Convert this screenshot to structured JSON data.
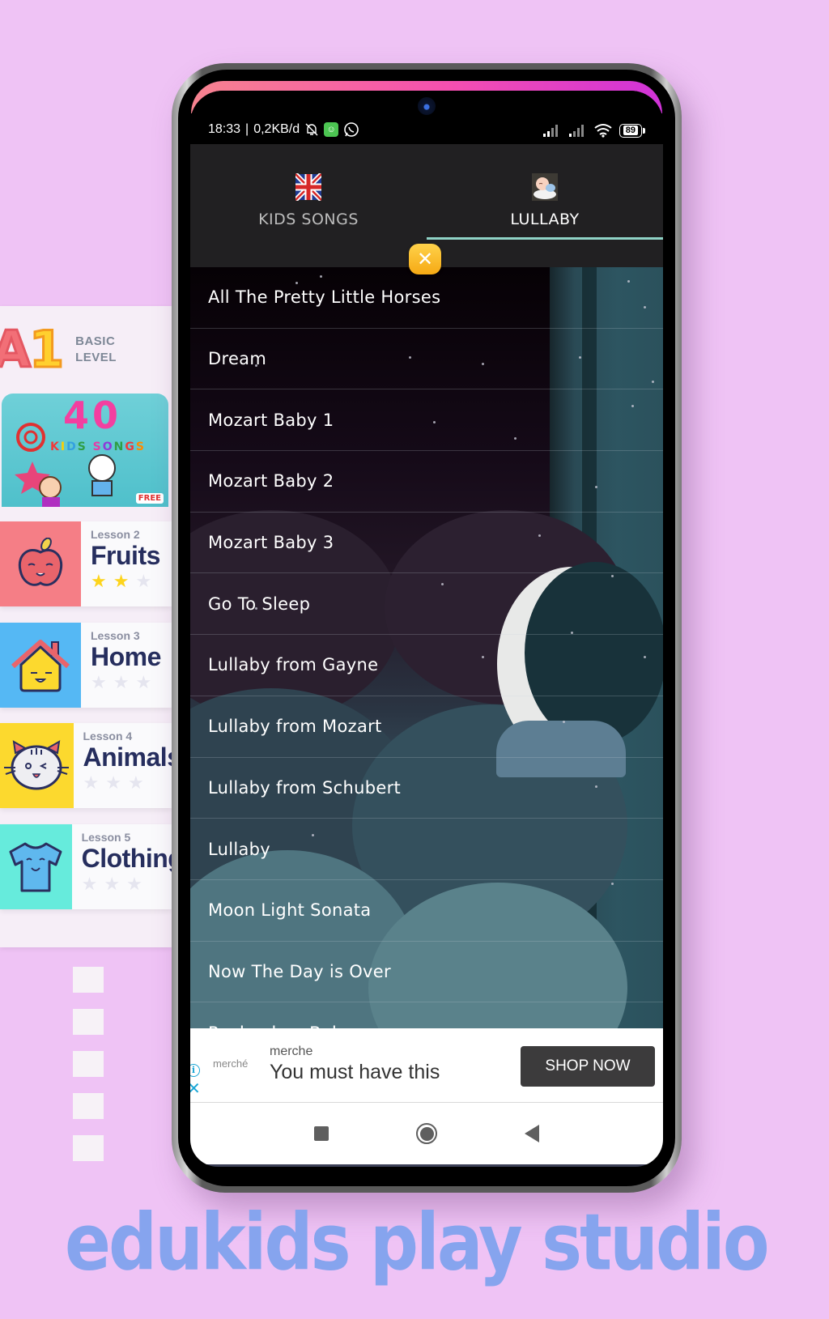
{
  "promo": {
    "level_badge": "A1",
    "level_text_line1": "BASIC",
    "level_text_line2": "LEVEL",
    "cover": {
      "number": "40",
      "kids": [
        "K",
        "I",
        "D",
        "S"
      ],
      "songs": [
        "S",
        "O",
        "N",
        "G",
        "S"
      ],
      "free_label": "FREE"
    },
    "lessons": [
      {
        "number": "Lesson 2",
        "title": "Fruits",
        "icon": "apple-icon",
        "color": "#f57e86",
        "stars_earned": 2,
        "stars_total": 3
      },
      {
        "number": "Lesson 3",
        "title": "Home",
        "icon": "house-icon",
        "color": "#55b8f4",
        "stars_earned": 0,
        "stars_total": 3
      },
      {
        "number": "Lesson 4",
        "title": "Animals",
        "icon": "cat-icon",
        "color": "#fcd92e",
        "stars_earned": 0,
        "stars_total": 3
      },
      {
        "number": "Lesson 5",
        "title": "Clothing",
        "icon": "tshirt-icon",
        "color": "#66ebdc",
        "stars_earned": 0,
        "stars_total": 3
      }
    ]
  },
  "statusbar": {
    "time": "18:33",
    "separator": "|",
    "data_rate": "0,2KB/d",
    "battery": "89"
  },
  "tabs": [
    {
      "label": "KIDS SONGS",
      "icon": "uk-flag-icon",
      "selected": false
    },
    {
      "label": "LULLABY",
      "icon": "sleeping-baby-icon",
      "selected": true
    }
  ],
  "colors": {
    "tab_indicator": "#8fd3c6",
    "header_bg": "#212022",
    "close_badge": "#f6b523",
    "brand_text": "#86a4ee",
    "page_bg": "#efc3f5"
  },
  "songs": [
    "All The Pretty Little Horses",
    "Dream",
    "Mozart Baby 1",
    "Mozart Baby 2",
    "Mozart Baby 3",
    "Go To Sleep",
    "Lullaby from Gayne",
    "Lullaby from Mozart",
    "Lullaby from Schubert",
    "Lullaby",
    "Moon Light Sonata",
    "Now The Day is Over",
    "Rock a bye Baby"
  ],
  "ad": {
    "logo_text": "merché",
    "advertiser": "merche",
    "headline": "You must have this",
    "cta": "SHOP NOW",
    "info_glyph": "i",
    "close_glyph": "✕"
  },
  "brand": {
    "text": "edukids play studio"
  }
}
